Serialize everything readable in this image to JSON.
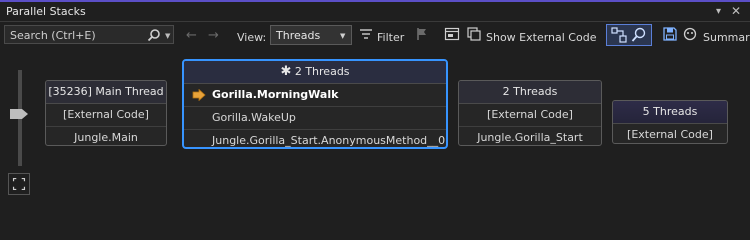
{
  "window": {
    "title": "Parallel Stacks",
    "accent_color": "#5b4fc7"
  },
  "toolbar": {
    "search_placeholder": "Search (Ctrl+E)",
    "view_label": "View:",
    "view_value": "Threads",
    "filter_label": "Filter",
    "show_external_label": "Show External Code",
    "summary_label": "Summar"
  },
  "nodes": [
    {
      "header": "[35236] Main Thread",
      "frames": [
        "[External Code]",
        "Jungle.Main"
      ]
    },
    {
      "header": "2 Threads",
      "header_prefix": "✱",
      "selected": true,
      "frames": [
        "Gorilla.MorningWalk",
        "Gorilla.WakeUp",
        "Jungle.Gorilla_Start.AnonymousMethod__0"
      ],
      "active_frame": "Gorilla.MorningWalk"
    },
    {
      "header": "2 Threads",
      "frames": [
        "[External Code]",
        "Jungle.Gorilla_Start"
      ]
    },
    {
      "header": "5 Threads",
      "frames": [
        "[External Code]"
      ]
    }
  ],
  "colors": {
    "selection": "#3794ff",
    "active_arrow": "#e8a33a"
  }
}
